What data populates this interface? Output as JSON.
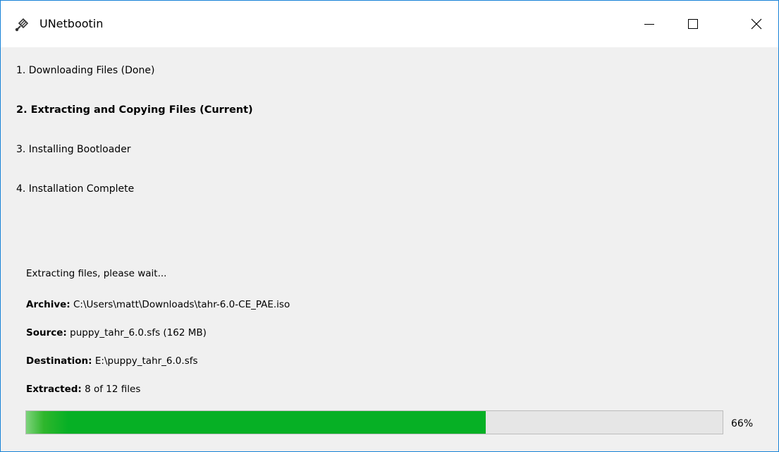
{
  "window": {
    "title": "UNetbootin",
    "icon": "unetbootin-icon"
  },
  "steps": [
    {
      "label": "1. Downloading Files (Done)",
      "state": "done"
    },
    {
      "label": "2. Extracting and Copying Files (Current)",
      "state": "current"
    },
    {
      "label": "3. Installing Bootloader",
      "state": "pending"
    },
    {
      "label": "4. Installation Complete",
      "state": "pending"
    }
  ],
  "status": {
    "message": "Extracting files, please wait...",
    "archive_label": "Archive:",
    "archive_value": "C:\\Users\\matt\\Downloads\\tahr-6.0-CE_PAE.iso",
    "source_label": "Source:",
    "source_value": "puppy_tahr_6.0.sfs (162 MB)",
    "destination_label": "Destination:",
    "destination_value": "E:\\puppy_tahr_6.0.sfs",
    "extracted_label": "Extracted:",
    "extracted_value": "8 of 12 files"
  },
  "progress": {
    "percent": 66,
    "text": "66%",
    "color": "#06b025"
  }
}
